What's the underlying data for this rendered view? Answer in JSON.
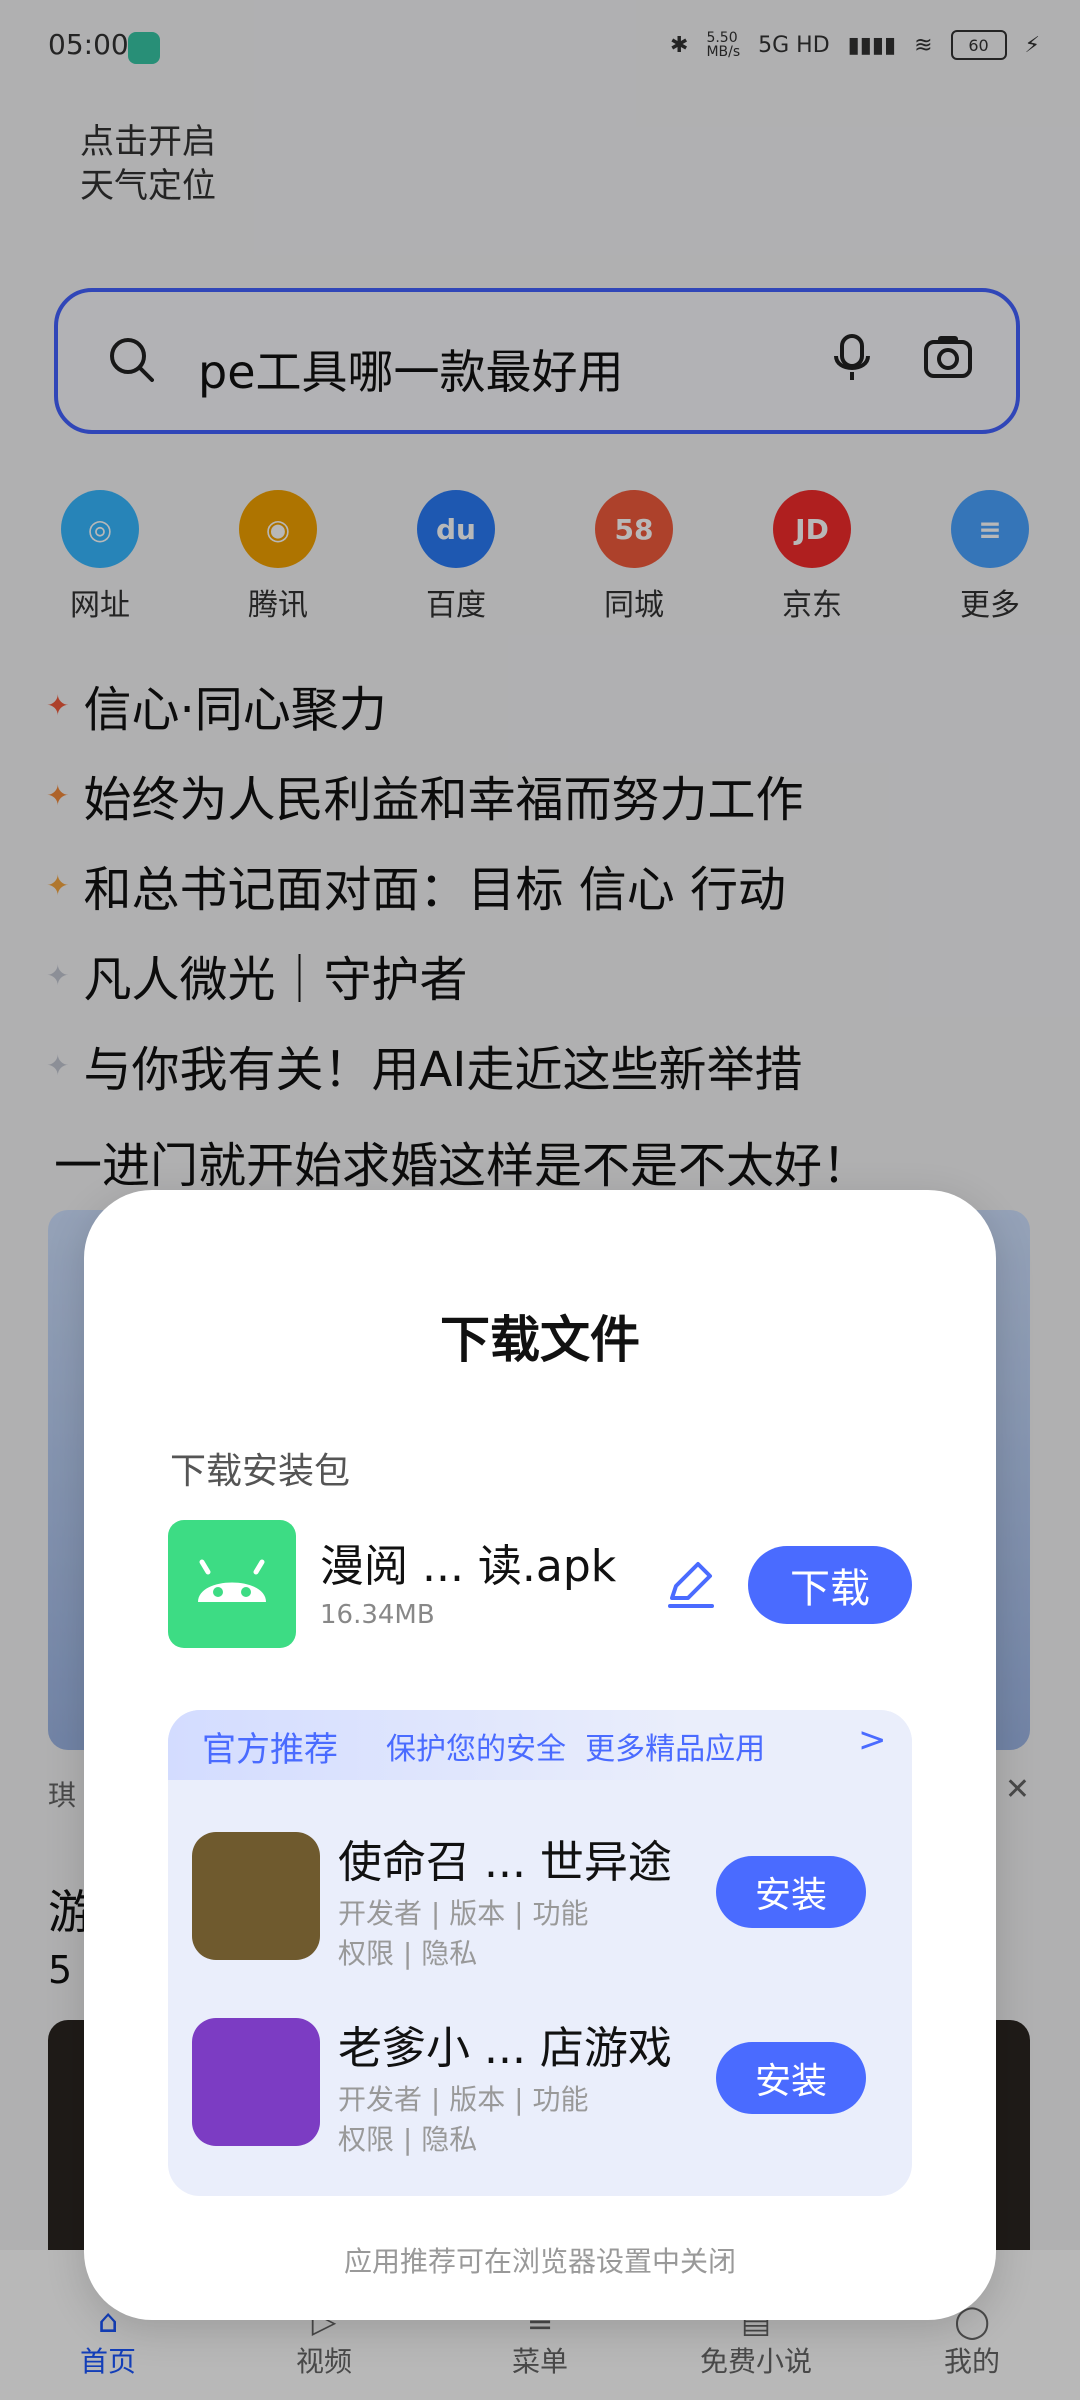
{
  "status": {
    "time": "05:00",
    "speed": "5.50\nMB/s",
    "network": "5G HD",
    "battery": "60"
  },
  "header": {
    "location_hint": "点击开启\n天气定位"
  },
  "search": {
    "query": "pe工具哪一款最好用"
  },
  "shortcuts": [
    {
      "label": "网址",
      "color": "#36b7ff"
    },
    {
      "label": "腾讯",
      "color": "#f2a100"
    },
    {
      "label": "百度",
      "color": "#2a7bf6"
    },
    {
      "label": "同城",
      "color": "#f05b3c"
    },
    {
      "label": "京东",
      "color": "#f32b2b"
    },
    {
      "label": "更多",
      "color": "#4aa3ff"
    }
  ],
  "headlines": [
    {
      "text": "信心·同心聚力",
      "star_color": "#f05b3c"
    },
    {
      "text": "始终为人民利益和幸福而努力工作",
      "star_color": "#f28a3b"
    },
    {
      "text": "和总书记面对面：目标 信心 行动",
      "star_color": "#f4a640"
    },
    {
      "text": "凡人微光｜守护者",
      "star_color": "#c2c6d1"
    },
    {
      "text": "与你我有关！用AI走近这些新举措",
      "star_color": "#c2c6d1"
    }
  ],
  "feed": {
    "title": "一进门就开始求婚这样是不是不太好！",
    "source": "琪",
    "close": "✕",
    "title2": "游",
    "sub2": "5"
  },
  "bottom_nav": [
    {
      "label": "首页",
      "active": true
    },
    {
      "label": "视频",
      "active": false
    },
    {
      "label": "菜单",
      "active": false
    },
    {
      "label": "免费小说",
      "active": false
    },
    {
      "label": "我的",
      "active": false
    }
  ],
  "dialog": {
    "title": "下载文件",
    "subtitle": "下载安装包",
    "apk": {
      "name": "漫阅 ... 读.apk",
      "size": "16.34MB",
      "download_label": "下载"
    },
    "recommend": {
      "official": "官方推荐",
      "text": "保护您的安全  更多精品应用",
      "chevron": ">"
    },
    "apps": [
      {
        "name": "使命召 ... 世异途",
        "meta1": "开发者 | 版本 | 功能",
        "meta2": "权限 | 隐私",
        "install_label": "安装",
        "icon_color": "#6f5a2e"
      },
      {
        "name": "老爹小 ... 店游戏",
        "meta1": "开发者 | 版本 | 功能",
        "meta2": "权限 | 隐私",
        "install_label": "安装",
        "icon_color": "#7c3cc3"
      }
    ],
    "footer": "应用推荐可在浏览器设置中关闭"
  }
}
